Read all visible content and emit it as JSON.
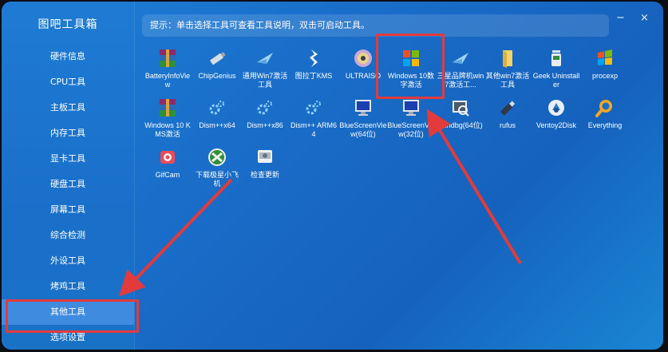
{
  "app": {
    "title": "图吧工具箱"
  },
  "hint": "提示：单击选择工具可查看工具说明，双击可启动工具。",
  "window_controls": {
    "minimize": "−",
    "close": "×"
  },
  "sidebar": {
    "items": [
      {
        "label": "硬件信息",
        "active": false
      },
      {
        "label": "CPU工具",
        "active": false
      },
      {
        "label": "主板工具",
        "active": false
      },
      {
        "label": "内存工具",
        "active": false
      },
      {
        "label": "显卡工具",
        "active": false
      },
      {
        "label": "硬盘工具",
        "active": false
      },
      {
        "label": "屏幕工具",
        "active": false
      },
      {
        "label": "综合检测",
        "active": false
      },
      {
        "label": "外设工具",
        "active": false
      },
      {
        "label": "烤鸡工具",
        "active": false
      },
      {
        "label": "其他工具",
        "active": true
      },
      {
        "label": "选项设置",
        "active": false
      }
    ]
  },
  "tools": [
    {
      "label": "BatteryInfoView",
      "icon": "winrar-icon"
    },
    {
      "label": "ChipGenius",
      "icon": "usb-drive-icon"
    },
    {
      "label": "通用Win7激活工具",
      "icon": "win7-activator-icon"
    },
    {
      "label": "图拉丁KMS",
      "icon": "kms-icon"
    },
    {
      "label": "ULTRAISO",
      "icon": "disc-icon"
    },
    {
      "label": "Windows 10数字激活",
      "icon": "windows-logo-icon"
    },
    {
      "label": "三星品牌机win7激活工...",
      "icon": "win7-activator-icon"
    },
    {
      "label": "其他win7激活工具",
      "icon": "folder-icon"
    },
    {
      "label": "Geek Uninstaller",
      "icon": "trash-icon"
    },
    {
      "label": "procexp",
      "icon": "windows-flag-icon"
    },
    {
      "label": "Windows 10 KMS激活",
      "icon": "winrar-icon"
    },
    {
      "label": "Dism++x64",
      "icon": "gear-icon"
    },
    {
      "label": "Dism++x86",
      "icon": "gear-icon"
    },
    {
      "label": "Dism++ ARM64",
      "icon": "gear-icon"
    },
    {
      "label": "BlueScreenView(64位)",
      "icon": "monitor-icon"
    },
    {
      "label": "BlueScreenView(32位)",
      "icon": "monitor-icon"
    },
    {
      "label": "Windbg(64位)",
      "icon": "debugger-icon"
    },
    {
      "label": "rufus",
      "icon": "usb-drive-icon"
    },
    {
      "label": "Ventoy2Disk",
      "icon": "ventoy-icon"
    },
    {
      "label": "Everything",
      "icon": "magnifier-icon"
    },
    {
      "label": "GifCam",
      "icon": "camera-icon"
    },
    {
      "label": "下载极星小飞机",
      "icon": "xbox-icon"
    },
    {
      "label": "检查更新",
      "icon": "update-icon"
    }
  ],
  "colors": {
    "accent": "#3f8be0",
    "annotation": "#e33b3b"
  }
}
